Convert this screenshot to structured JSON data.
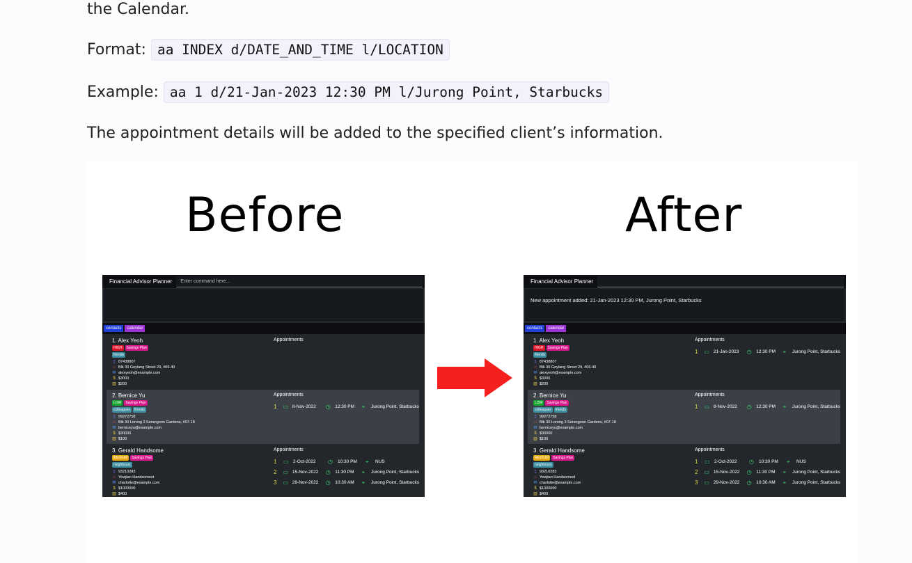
{
  "doc": {
    "intro_tail": "the Calendar.",
    "format_label": "Format:",
    "format_code": "aa INDEX d/DATE_AND_TIME l/LOCATION",
    "example_label": "Example:",
    "example_code": "aa 1 d/21-Jan-2023 12:30 PM l/Jurong Point, Starbucks",
    "description": "The appointment details will be added to the specified client’s information."
  },
  "figure": {
    "before_title": "Before",
    "after_title": "After",
    "arrow_color": "#f5201e"
  },
  "app": {
    "window_title": "Financial Advisor Planner",
    "command_placeholder": "Enter command here...",
    "result_after": "New appointment added: 21-Jan-2023 12:30 PM, Jurong Point, Starbucks",
    "tabs": [
      "contacts",
      "calendar"
    ],
    "appointments_header": "Appointments",
    "colors": {
      "high": "#e0162b",
      "low": "#17a52c",
      "medium": "#e6a80b",
      "tag_pink": "#d61a8c",
      "tag_teal": "#3d8ea0",
      "green_icon": "#39d36e"
    },
    "clients": [
      {
        "name": "1.  Alex Yeoh",
        "priority": "HIGH",
        "plan": "Savings Plan",
        "tags": [
          "friends"
        ],
        "phone": "87438807",
        "address": "Blk 30 Geylang Street 29, #06-40",
        "email": "alexyeoh@example.com",
        "income": "$3000",
        "monthly": "$200"
      },
      {
        "name": "2.  Bernice Yu",
        "priority": "LOW",
        "plan": "Savings Plan",
        "tags": [
          "colleagues",
          "friends"
        ],
        "phone": "99272758",
        "address": "Blk 30 Lorong 3 Serangoon Gardens, #07-18",
        "email": "berniceyu@example.com",
        "income": "$30000",
        "monthly": "$100"
      },
      {
        "name": "3.  Gerald Handsome",
        "priority": "MEDIUM",
        "plan": "Savings Plan",
        "tags": [
          "neighbours"
        ],
        "phone": "93210283",
        "address": "Yewjian Handsomest",
        "email": "charlotte@example.com",
        "income": "$1000000",
        "monthly": "$400"
      }
    ],
    "appointments_before": [
      [],
      [
        {
          "num": "1",
          "date": "8-Nov-2022",
          "time": "12:30 PM",
          "loc": "Jurong Point, Starbucks"
        }
      ],
      [
        {
          "num": "1",
          "date": "2-Oct-2022",
          "time": "10:30 PM",
          "loc": "NUS"
        },
        {
          "num": "2",
          "date": "15-Nov-2022",
          "time": "11:30 PM",
          "loc": "Jurong Point, Starbucks"
        },
        {
          "num": "3",
          "date": "29-Nov-2022",
          "time": "10:30 AM",
          "loc": "Jurong Point, Starbucks"
        }
      ]
    ],
    "appointments_after": [
      [
        {
          "num": "1",
          "date": "21-Jan-2023",
          "time": "12:30 PM",
          "loc": "Jurong Point, Starbucks"
        }
      ],
      [
        {
          "num": "1",
          "date": "8-Nov-2022",
          "time": "12:30 PM",
          "loc": "Jurong Point, Starbucks"
        }
      ],
      [
        {
          "num": "1",
          "date": "2-Oct-2022",
          "time": "10:30 PM",
          "loc": "NUS"
        },
        {
          "num": "2",
          "date": "15-Nov-2022",
          "time": "11:30 PM",
          "loc": "Jurong Point, Starbucks"
        },
        {
          "num": "3",
          "date": "29-Nov-2022",
          "time": "10:30 AM",
          "loc": "Jurong Point, Starbucks"
        }
      ]
    ]
  }
}
